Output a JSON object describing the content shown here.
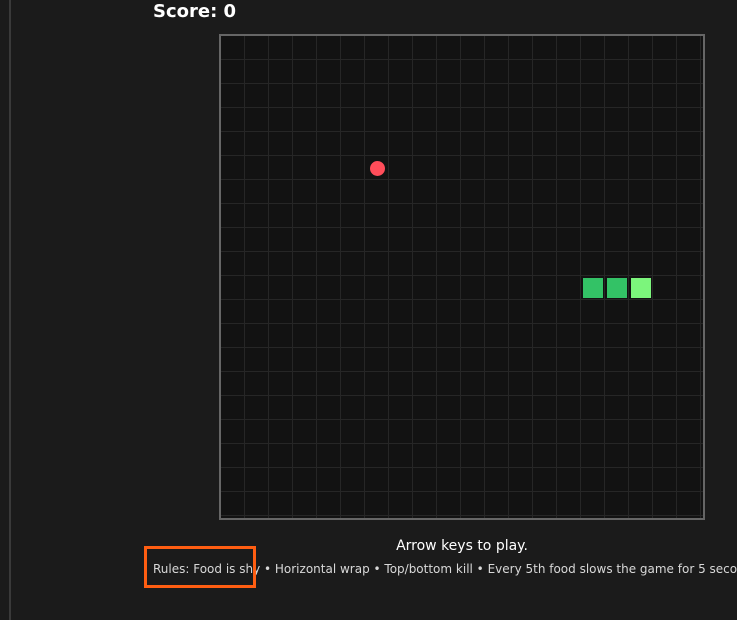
{
  "score": {
    "label": "Score: 0"
  },
  "board": {
    "grid_columns": 20,
    "grid_rows": 20,
    "food": {
      "col": 6,
      "row": 5,
      "color": "#ff4d5a"
    },
    "snake": {
      "body_color": "#33c266",
      "head_color": "#7cf57c",
      "segments": [
        {
          "col": 15,
          "row": 10,
          "part": "body"
        },
        {
          "col": 16,
          "row": 10,
          "part": "body"
        },
        {
          "col": 17,
          "row": 10,
          "part": "head"
        }
      ]
    }
  },
  "hint": "Arrow keys to play.",
  "rules": "Rules: Food is shy • Horizontal wrap • Top/bottom kill • Every 5th food slows the game for 5 seconds",
  "highlight": {
    "color": "#ff5e12"
  }
}
